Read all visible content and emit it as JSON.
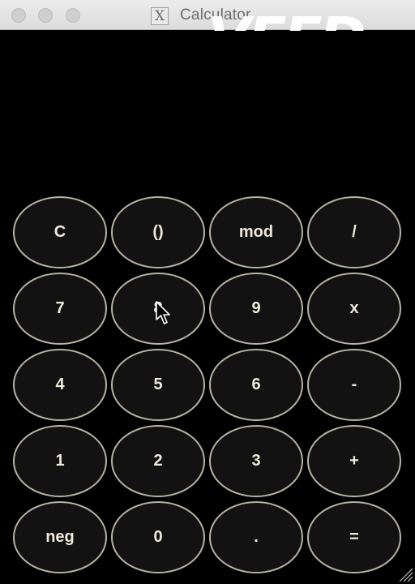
{
  "window": {
    "title": "Calculator",
    "app_icon_glyph": "X",
    "watermark": "VEED"
  },
  "display": {
    "value": ""
  },
  "keypad": {
    "rows": [
      [
        "C",
        "()",
        "mod",
        "/"
      ],
      [
        "7",
        "8",
        "9",
        "x"
      ],
      [
        "4",
        "5",
        "6",
        "-"
      ],
      [
        "1",
        "2",
        "3",
        "+"
      ],
      [
        "neg",
        "0",
        ".",
        "="
      ]
    ]
  },
  "colors": {
    "background": "#000000",
    "key_fill": "#121212",
    "key_border": "#b8b2a3",
    "key_text": "#efe9d8"
  },
  "icons": {
    "close": "close-button-icon",
    "minimize": "minimize-button-icon",
    "zoom": "zoom-button-icon",
    "cursor": "mouse-pointer-icon",
    "resize": "resize-grip-icon"
  }
}
